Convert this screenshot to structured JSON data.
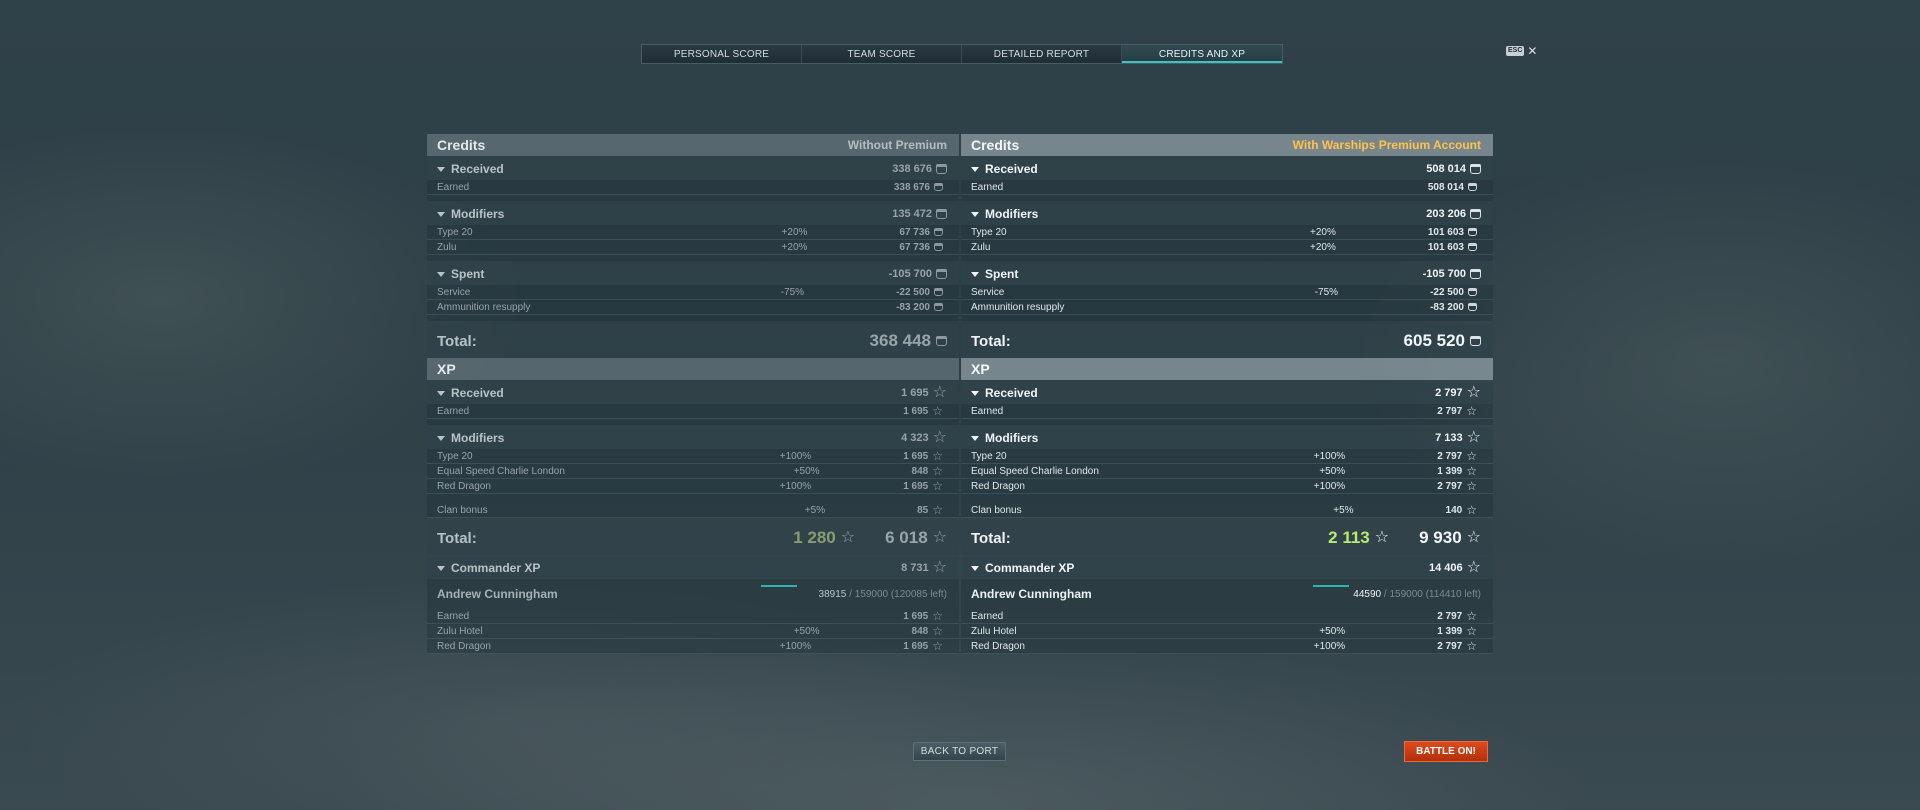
{
  "tabs": [
    "PERSONAL SCORE",
    "TEAM SCORE",
    "DETAILED REPORT",
    "CREDITS AND XP"
  ],
  "active_tab": 3,
  "esc": {
    "key": "ESC",
    "close": "✕"
  },
  "left": {
    "credits_title": "Credits",
    "credits_note": "Without Premium",
    "received": {
      "label": "Received",
      "amount": "338 676"
    },
    "earned": {
      "label": "Earned",
      "amount": "338 676"
    },
    "modifiers": {
      "label": "Modifiers",
      "amount": "135 472"
    },
    "mod_rows": [
      {
        "label": "Type 20",
        "pct": "+20%",
        "amount": "67 736"
      },
      {
        "label": "Zulu",
        "pct": "+20%",
        "amount": "67 736"
      }
    ],
    "spent": {
      "label": "Spent",
      "amount": "-105 700"
    },
    "spent_rows": [
      {
        "label": "Service",
        "pct": "-75%",
        "amount": "-22 500"
      },
      {
        "label": "Ammunition resupply",
        "pct": "",
        "amount": "-83 200"
      }
    ],
    "credits_total": {
      "label": "Total:",
      "amount": "368 448"
    },
    "xp_title": "XP",
    "xp_received": {
      "label": "Received",
      "amount": "1 695"
    },
    "xp_earned": {
      "label": "Earned",
      "amount": "1 695"
    },
    "xp_modifiers": {
      "label": "Modifiers",
      "amount": "4 323"
    },
    "xp_mod_rows": [
      {
        "label": "Type 20",
        "pct": "+100%",
        "amount": "1 695"
      },
      {
        "label": "Equal Speed Charlie London",
        "pct": "+50%",
        "amount": "848"
      },
      {
        "label": "Red Dragon",
        "pct": "+100%",
        "amount": "1 695"
      }
    ],
    "clan": {
      "label": "Clan bonus",
      "pct": "+5%",
      "amount": "85"
    },
    "xp_total": {
      "label": "Total:",
      "sub": "1 280",
      "amount": "6 018"
    },
    "cmdr_xp": {
      "label": "Commander XP",
      "amount": "8 731"
    },
    "cmdr_name": "Andrew Cunningham",
    "cmdr_cur": "38915",
    "cmdr_rest": " / 159000 (120085 left)",
    "cmdr_progress": 0.245,
    "cmdr_rows": [
      {
        "label": "Earned",
        "pct": "",
        "amount": "1 695"
      },
      {
        "label": "Zulu Hotel",
        "pct": "+50%",
        "amount": "848"
      },
      {
        "label": "Red Dragon",
        "pct": "+100%",
        "amount": "1 695"
      }
    ]
  },
  "right": {
    "credits_title": "Credits",
    "credits_note": "With Warships Premium Account",
    "received": {
      "label": "Received",
      "amount": "508 014"
    },
    "earned": {
      "label": "Earned",
      "amount": "508 014"
    },
    "modifiers": {
      "label": "Modifiers",
      "amount": "203 206"
    },
    "mod_rows": [
      {
        "label": "Type 20",
        "pct": "+20%",
        "amount": "101 603"
      },
      {
        "label": "Zulu",
        "pct": "+20%",
        "amount": "101 603"
      }
    ],
    "spent": {
      "label": "Spent",
      "amount": "-105 700"
    },
    "spent_rows": [
      {
        "label": "Service",
        "pct": "-75%",
        "amount": "-22 500"
      },
      {
        "label": "Ammunition resupply",
        "pct": "",
        "amount": "-83 200"
      }
    ],
    "credits_total": {
      "label": "Total:",
      "amount": "605 520"
    },
    "xp_title": "XP",
    "xp_received": {
      "label": "Received",
      "amount": "2 797"
    },
    "xp_earned": {
      "label": "Earned",
      "amount": "2 797"
    },
    "xp_modifiers": {
      "label": "Modifiers",
      "amount": "7 133"
    },
    "xp_mod_rows": [
      {
        "label": "Type 20",
        "pct": "+100%",
        "amount": "2 797"
      },
      {
        "label": "Equal Speed Charlie London",
        "pct": "+50%",
        "amount": "1 399"
      },
      {
        "label": "Red Dragon",
        "pct": "+100%",
        "amount": "2 797"
      }
    ],
    "clan": {
      "label": "Clan bonus",
      "pct": "+5%",
      "amount": "140"
    },
    "xp_total": {
      "label": "Total:",
      "sub": "2 113",
      "amount": "9 930"
    },
    "cmdr_xp": {
      "label": "Commander XP",
      "amount": "14 406"
    },
    "cmdr_name": "Andrew Cunningham",
    "cmdr_cur": "44590",
    "cmdr_rest": " / 159000 (114410 left)",
    "cmdr_progress": 0.28,
    "cmdr_rows": [
      {
        "label": "Earned",
        "pct": "",
        "amount": "2 797"
      },
      {
        "label": "Zulu Hotel",
        "pct": "+50%",
        "amount": "1 399"
      },
      {
        "label": "Red Dragon",
        "pct": "+100%",
        "amount": "2 797"
      }
    ]
  },
  "buttons": {
    "back": "BACK TO PORT",
    "battle": "BATTLE ON!"
  },
  "colors": {
    "accent": "#3ec2c4",
    "premium": "#ffc24a",
    "battle": "#d8431a",
    "xp_bonus": "#b7ec6e"
  },
  "icons": {
    "credits": "credits-coin-icon",
    "xp": "xp-star-icon"
  }
}
